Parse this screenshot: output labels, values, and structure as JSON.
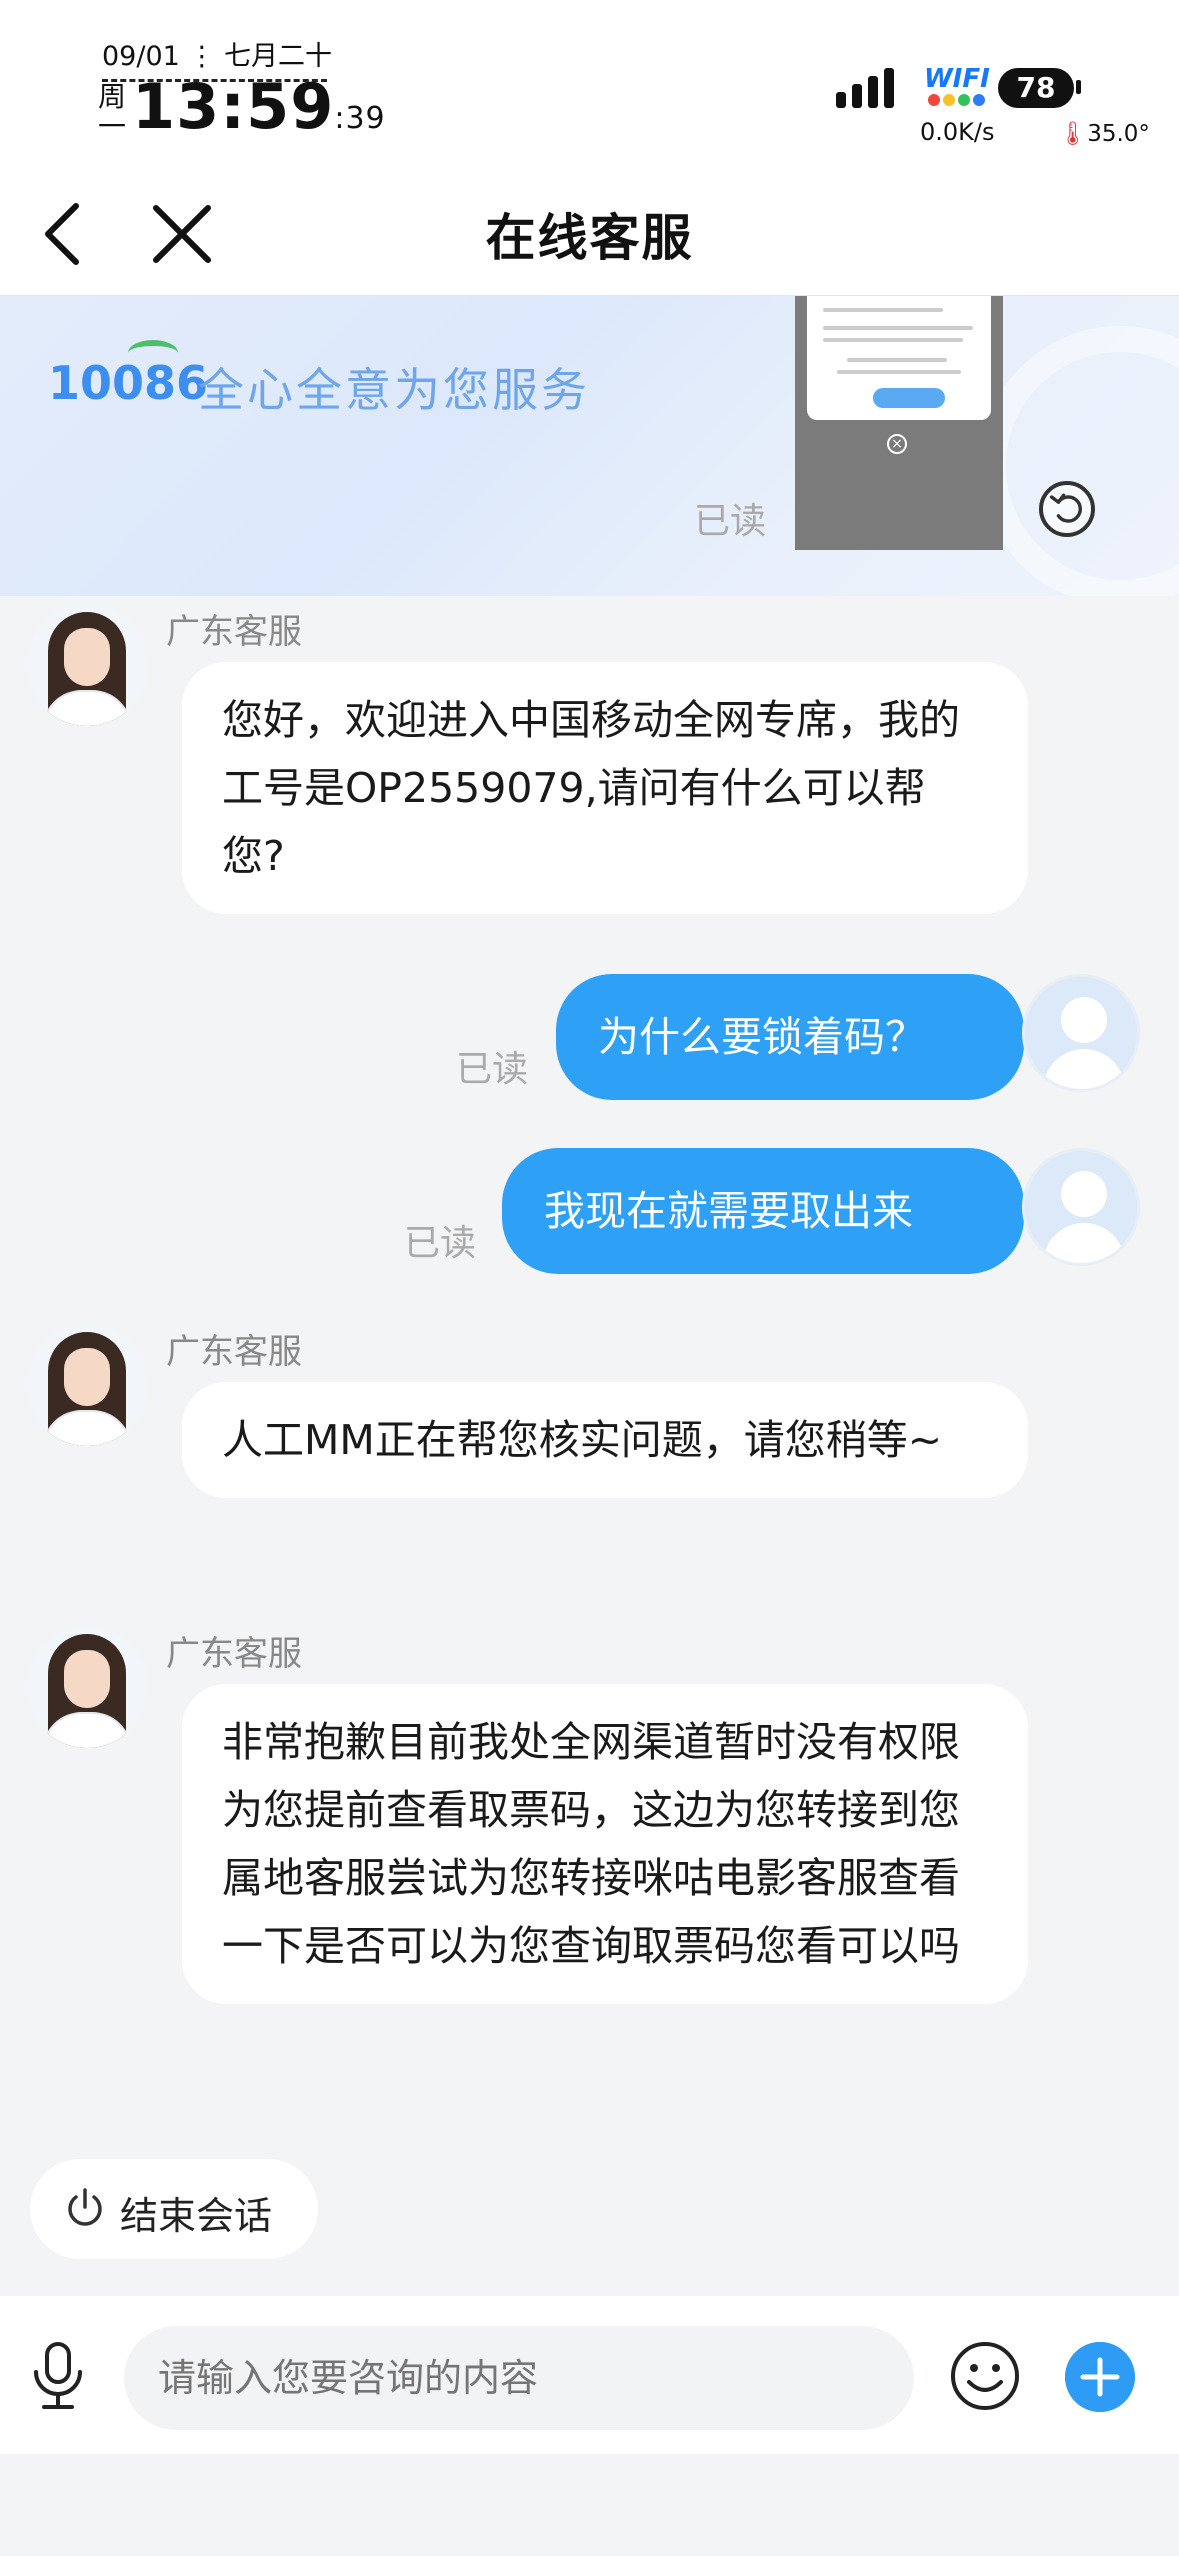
{
  "status_bar": {
    "date": "09/01 ⋮ 七月二十",
    "weekday": "周一",
    "time_main": "13:59",
    "time_seconds": ":39",
    "wifi_label": "WIFI",
    "battery": "78",
    "net_speed": "0.0K/s",
    "temperature": "35.0°"
  },
  "nav": {
    "title": "在线客服",
    "back_icon": "chevron-left-icon",
    "close_icon": "close-icon"
  },
  "banner": {
    "logo": "10086",
    "slogan": "全心全意为您服务",
    "read": "已读"
  },
  "messages": {
    "m1": {
      "name": "广东客服",
      "text": "您好，欢迎进入中国移动全网专席，我的工号是OP2559079,请问有什么可以帮您?"
    },
    "m2": {
      "read": "已读",
      "text": "为什么要锁着码？"
    },
    "m3": {
      "read": "已读",
      "text": "我现在就需要取出来"
    },
    "m4": {
      "name": "广东客服",
      "text": "人工MM正在帮您核实问题，请您稍等~"
    },
    "m5": {
      "name": "广东客服",
      "text": "非常抱歉目前我处全网渠道暂时没有权限为您提前查看取票码，这边为您转接到您属地客服尝试为您转接咪咕电影客服查看一下是否可以为您查询取票码您看可以吗"
    }
  },
  "end_session": {
    "label": "结束会话",
    "icon": "power-icon"
  },
  "input": {
    "placeholder": "请输入您要咨询的内容",
    "icons": [
      "microphone-icon",
      "emoji-icon",
      "plus-icon"
    ]
  },
  "colors": {
    "accent": "#2ea1f6",
    "background": "#f3f4f6"
  }
}
